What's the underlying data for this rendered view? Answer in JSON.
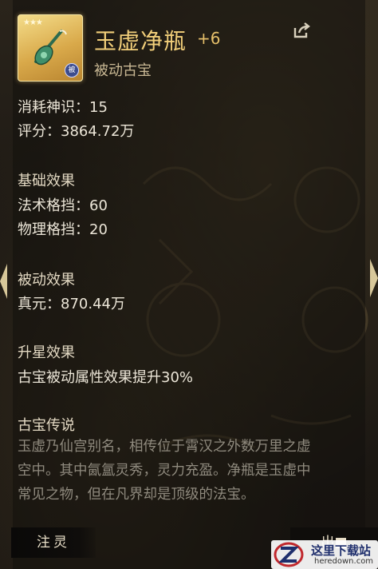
{
  "item": {
    "name": "玉虚净瓶",
    "enhance": "+6",
    "type": "被动古宝",
    "badge": "被",
    "icon": "jade-vase-icon"
  },
  "stats": {
    "cost_label": "消耗神识：",
    "cost_value": "15",
    "score_label": "评分：",
    "score_value": "3864.72万"
  },
  "base_effect": {
    "heading": "基础效果",
    "lines": [
      "法术格挡：60",
      "物理格挡：20"
    ]
  },
  "passive_effect": {
    "heading": "被动效果",
    "lines": [
      "真元：870.44万"
    ]
  },
  "star_effect": {
    "heading": "升星效果",
    "lines": [
      "古宝被动属性效果提升30%"
    ]
  },
  "lore": {
    "heading": "古宝传说",
    "lines": [
      "玉虚乃仙宫别名，相传位于霄汉之外数万里之虚",
      "空中。其中氤氲灵秀，灵力充盈。净瓶是玉虚中",
      "常见之物，但在凡界却是顶级的法宝。"
    ]
  },
  "buttons": {
    "infuse": "注灵",
    "right": "出■"
  },
  "watermark": {
    "title": "这里下载站",
    "url": "heredown.com"
  },
  "colors": {
    "title": "#f2cf7a",
    "text": "#ece6d8",
    "lore": "#8f8a7e",
    "icon_frame": "#d9a94a"
  }
}
